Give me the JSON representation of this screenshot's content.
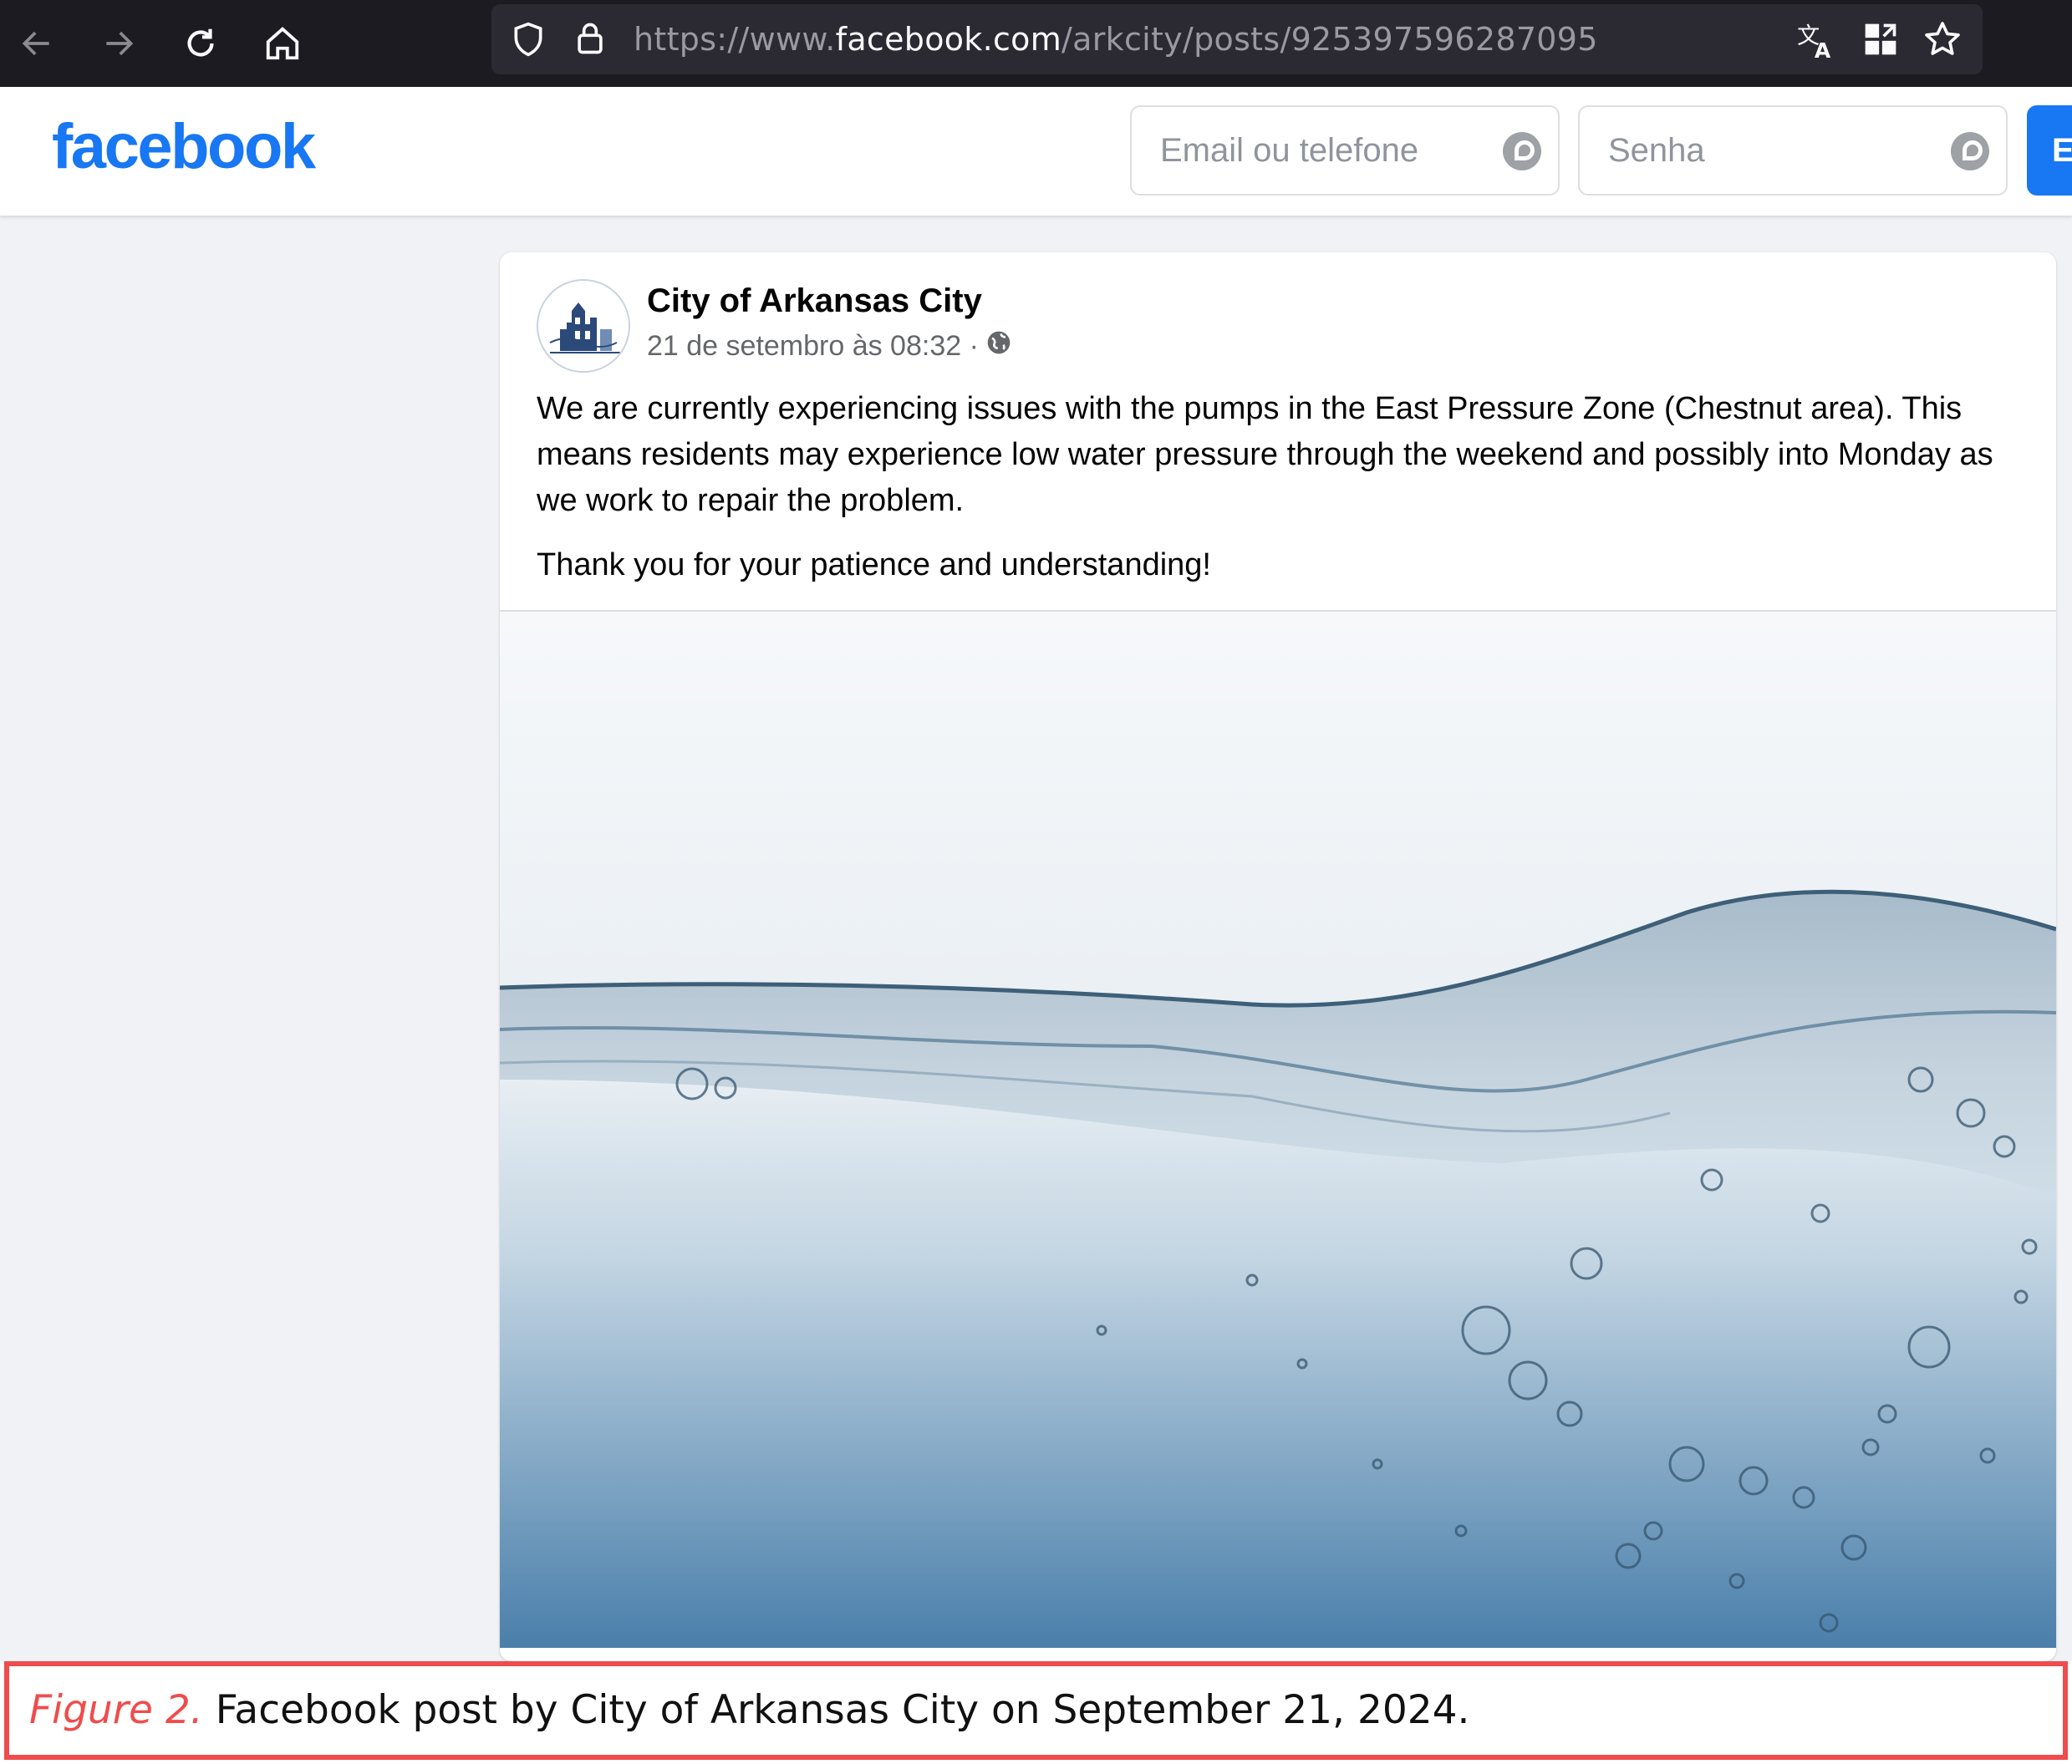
{
  "browser": {
    "url_prefix": "https://www.",
    "url_domain": "facebook.com",
    "url_path": "/arkcity/posts/925397596287095"
  },
  "fb": {
    "logo": "facebook",
    "email_placeholder": "Email ou telefone",
    "password_placeholder": "Senha",
    "login_label": "E"
  },
  "post": {
    "author": "City of Arkansas City",
    "timestamp": "21 de setembro às 08:32 ·",
    "paragraphs": [
      "We are currently experiencing issues with the pumps in the East Pressure Zone (Chestnut area). This means residents may experience low water pressure through the weekend and possibly into Monday as we work to repair the problem.",
      "Thank you for your patience and understanding!"
    ]
  },
  "caption": {
    "label": "Figure 2.",
    "text": "Facebook post by City of Arkansas City on September 21, 2024."
  },
  "colors": {
    "facebook_blue": "#1877f2",
    "caption_red": "#ef4c4c",
    "chrome_dark": "#1c1b22"
  },
  "icons": [
    "back-arrow-icon",
    "forward-arrow-icon",
    "reload-icon",
    "home-icon",
    "shield-icon",
    "lock-icon",
    "translate-icon",
    "qr-code-icon",
    "star-icon",
    "password-manager-icon",
    "globe-icon"
  ]
}
